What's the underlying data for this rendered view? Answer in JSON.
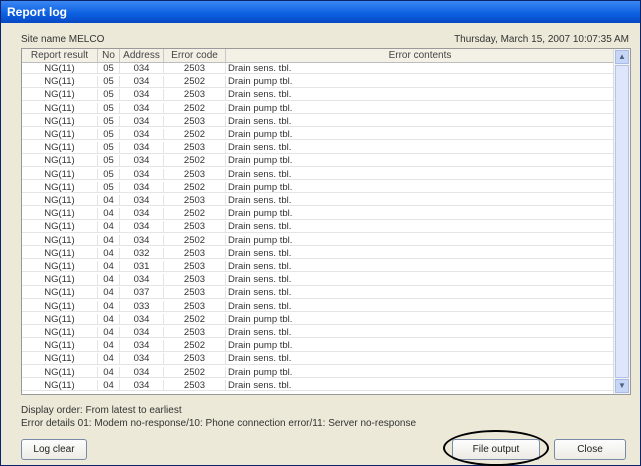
{
  "window": {
    "title": "Report log"
  },
  "info": {
    "site_name": "Site name MELCO",
    "datetime": "Thursday, March 15, 2007 10:07:35 AM"
  },
  "table": {
    "columns": [
      "Report result",
      "No",
      "Address",
      "Error code",
      "Error contents"
    ],
    "rows": [
      [
        "NG(11)",
        "05",
        "034",
        "2503",
        "Drain sens. tbl."
      ],
      [
        "NG(11)",
        "05",
        "034",
        "2502",
        "Drain pump tbl."
      ],
      [
        "NG(11)",
        "05",
        "034",
        "2503",
        "Drain sens. tbl."
      ],
      [
        "NG(11)",
        "05",
        "034",
        "2502",
        "Drain pump tbl."
      ],
      [
        "NG(11)",
        "05",
        "034",
        "2503",
        "Drain sens. tbl."
      ],
      [
        "NG(11)",
        "05",
        "034",
        "2502",
        "Drain pump tbl."
      ],
      [
        "NG(11)",
        "05",
        "034",
        "2503",
        "Drain sens. tbl."
      ],
      [
        "NG(11)",
        "05",
        "034",
        "2502",
        "Drain pump tbl."
      ],
      [
        "NG(11)",
        "05",
        "034",
        "2503",
        "Drain sens. tbl."
      ],
      [
        "NG(11)",
        "05",
        "034",
        "2502",
        "Drain pump tbl."
      ],
      [
        "NG(11)",
        "04",
        "034",
        "2503",
        "Drain sens. tbl."
      ],
      [
        "NG(11)",
        "04",
        "034",
        "2502",
        "Drain pump tbl."
      ],
      [
        "NG(11)",
        "04",
        "034",
        "2503",
        "Drain sens. tbl."
      ],
      [
        "NG(11)",
        "04",
        "034",
        "2502",
        "Drain pump tbl."
      ],
      [
        "NG(11)",
        "04",
        "032",
        "2503",
        "Drain sens. tbl."
      ],
      [
        "NG(11)",
        "04",
        "031",
        "2503",
        "Drain sens. tbl."
      ],
      [
        "NG(11)",
        "04",
        "034",
        "2503",
        "Drain sens. tbl."
      ],
      [
        "NG(11)",
        "04",
        "037",
        "2503",
        "Drain sens. tbl."
      ],
      [
        "NG(11)",
        "04",
        "033",
        "2503",
        "Drain sens. tbl."
      ],
      [
        "NG(11)",
        "04",
        "034",
        "2502",
        "Drain pump tbl."
      ],
      [
        "NG(11)",
        "04",
        "034",
        "2503",
        "Drain sens. tbl."
      ],
      [
        "NG(11)",
        "04",
        "034",
        "2502",
        "Drain pump tbl."
      ],
      [
        "NG(11)",
        "04",
        "034",
        "2503",
        "Drain sens. tbl."
      ],
      [
        "NG(11)",
        "04",
        "034",
        "2502",
        "Drain pump tbl."
      ],
      [
        "NG(11)",
        "04",
        "034",
        "2503",
        "Drain sens. tbl."
      ]
    ]
  },
  "notes": {
    "display_order": "Display order: From latest to earliest",
    "error_details": "Error details 01: Modem no-response/10: Phone connection error/11: Server no-response"
  },
  "buttons": {
    "log_clear": "Log clear",
    "file_output": "File output",
    "close": "Close"
  },
  "icons": {
    "scroll_up": "chevron-up-icon",
    "scroll_down": "chevron-down-icon"
  }
}
